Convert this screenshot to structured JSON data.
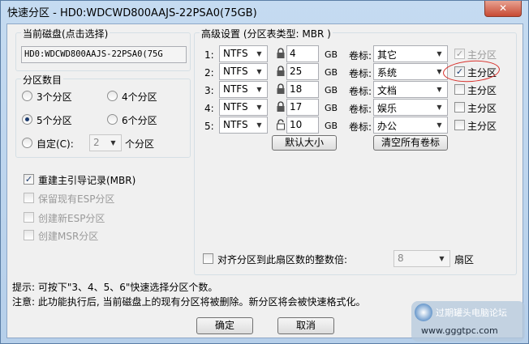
{
  "window": {
    "title": "快速分区 - HD0:WDCWD800AAJS-22PSA0(75GB)",
    "close_symbol": "✕"
  },
  "disk": {
    "label": "当前磁盘(点击选择)",
    "value": "HD0:WDCWD800AAJS-22PSA0(75G"
  },
  "partition_count": {
    "label": "分区数目",
    "options": [
      "3个分区",
      "4个分区",
      "5个分区",
      "6个分区"
    ],
    "selected": "5个分区",
    "custom_label": "自定(C):",
    "custom_value": "2",
    "custom_suffix": "个分区"
  },
  "mbr": {
    "rebuild_label": "重建主引导记录(MBR)",
    "keep_esp_label": "保留现有ESP分区",
    "create_esp_label": "创建新ESP分区",
    "create_msr_label": "创建MSR分区"
  },
  "advanced": {
    "label": "高级设置 (分区表类型: MBR )",
    "volume_label_text": "卷标:",
    "primary_label": "主分区",
    "unit": "GB",
    "rows": [
      {
        "index": "1:",
        "fs": "NTFS",
        "size": "4",
        "name": "其它",
        "primary": true,
        "primary_enabled": false
      },
      {
        "index": "2:",
        "fs": "NTFS",
        "size": "25",
        "name": "系统",
        "primary": true,
        "primary_enabled": true
      },
      {
        "index": "3:",
        "fs": "NTFS",
        "size": "18",
        "name": "文档",
        "primary": false,
        "primary_enabled": true
      },
      {
        "index": "4:",
        "fs": "NTFS",
        "size": "17",
        "name": "娱乐",
        "primary": false,
        "primary_enabled": true
      },
      {
        "index": "5:",
        "fs": "NTFS",
        "size": "10",
        "name": "办公",
        "primary": false,
        "primary_enabled": true
      }
    ],
    "default_size_button": "默认大小",
    "clear_labels_button": "清空所有卷标",
    "align_label": "对齐分区到此扇区数的整数倍:",
    "align_value": "8",
    "align_unit": "扇区"
  },
  "hints": {
    "line1": "提示: 可按下\"3、4、5、6\"快速选择分区个数。",
    "line2": "注意: 此功能执行后, 当前磁盘上的现有分区将被删除。新分区将会被快速格式化。"
  },
  "buttons": {
    "ok": "确定",
    "cancel": "取消"
  },
  "watermark": {
    "text": "过期罐头电脑论坛",
    "url": "www.gggtpc.com"
  },
  "colors": {
    "annotation": "#d8302b",
    "selection": "#1a3a6e"
  }
}
